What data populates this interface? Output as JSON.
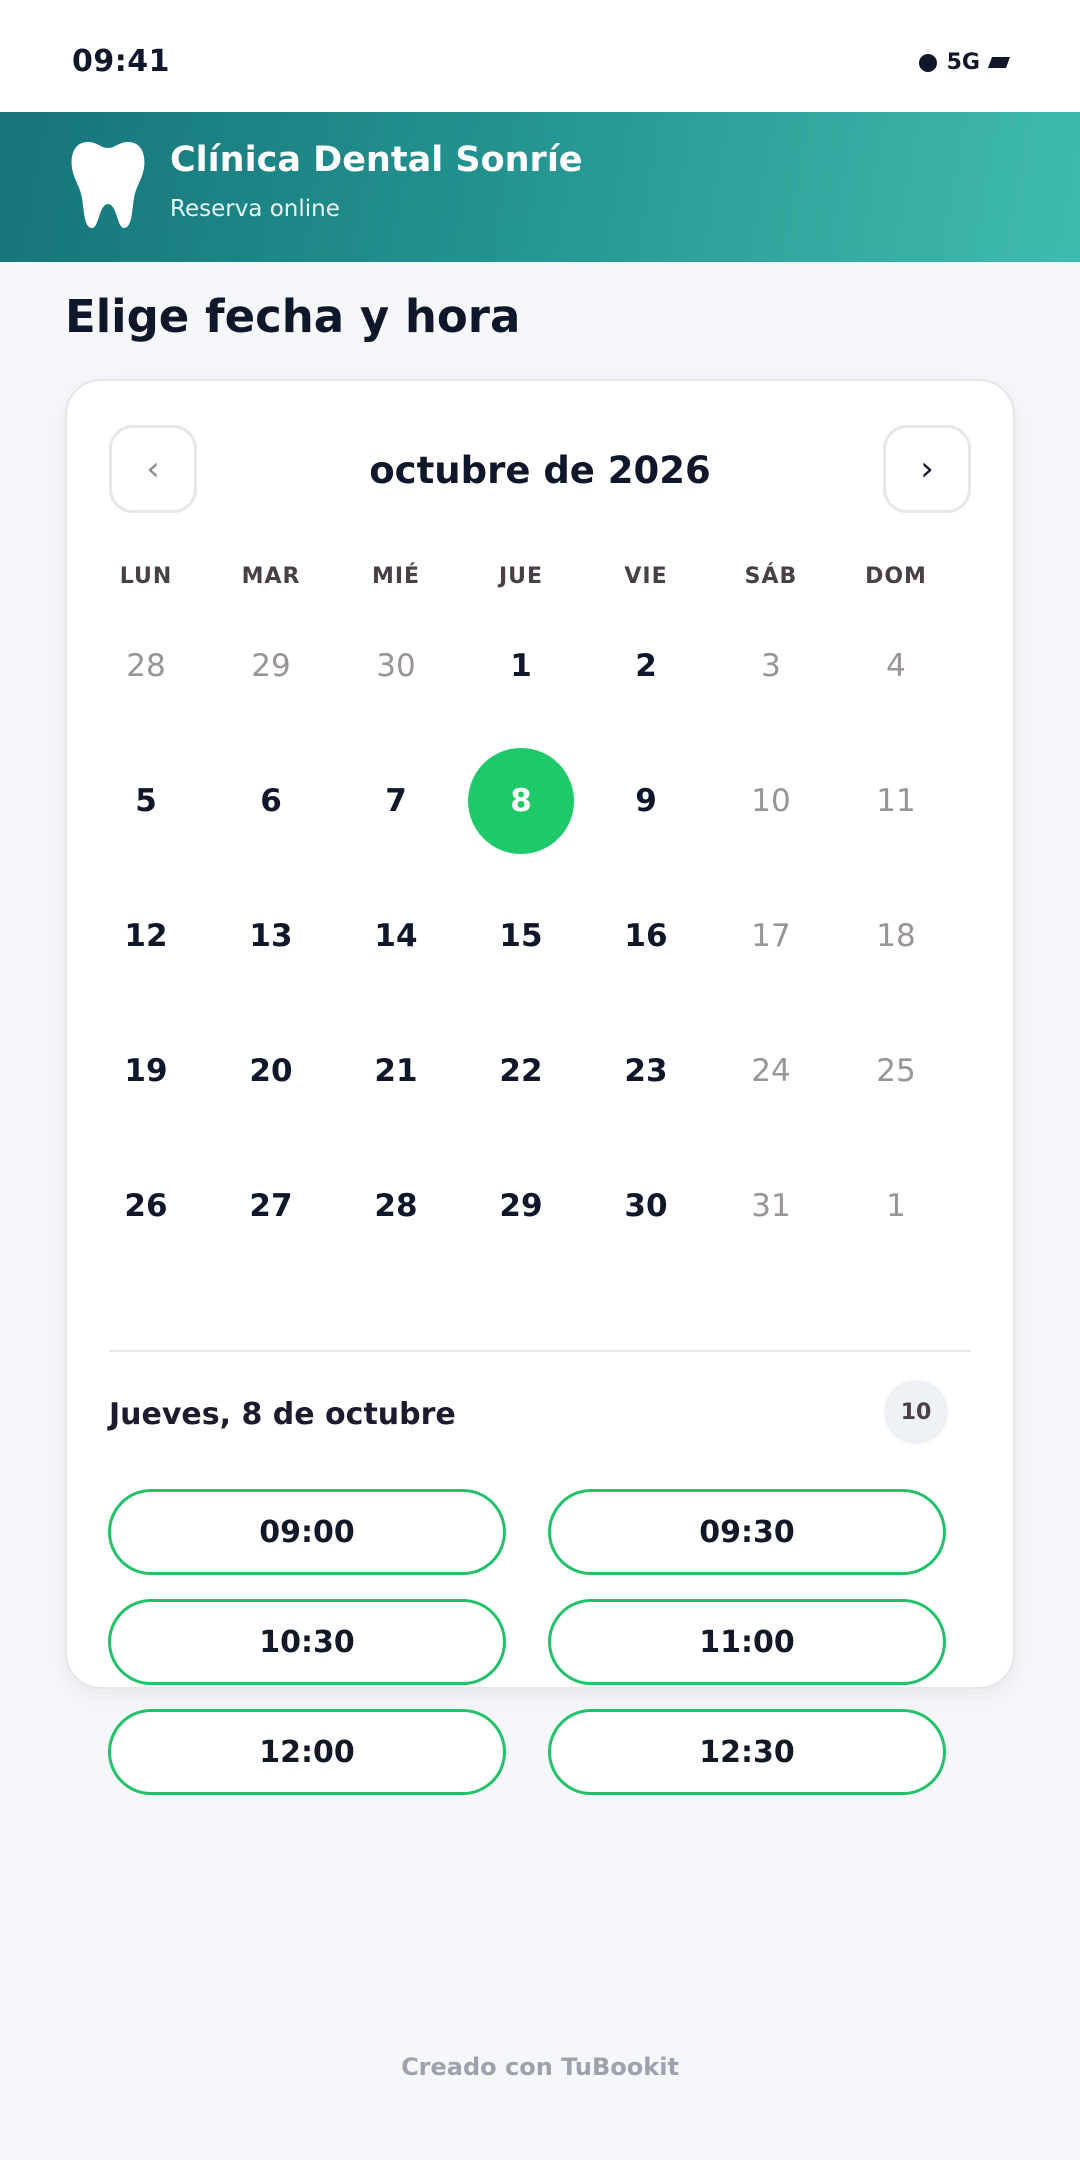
{
  "status": {
    "time": "09:41",
    "network": "5G",
    "icons": [
      "dot-icon",
      "battery-icon"
    ]
  },
  "header": {
    "icon": "tooth-icon",
    "title": "Clínica Dental Sonríe",
    "subtitle": "Reserva online"
  },
  "page": {
    "title": "Elige fecha y hora"
  },
  "calendar": {
    "month_label": "octubre de 2026",
    "prev_icon": "chevron-left-icon",
    "next_icon": "chevron-right-icon",
    "prev_label": "‹",
    "next_label": "›",
    "weekdays": [
      "LUN",
      "MAR",
      "MIÉ",
      "JUE",
      "VIE",
      "SÁB",
      "DOM"
    ],
    "weeks": [
      [
        {
          "d": "28",
          "s": "muted"
        },
        {
          "d": "29",
          "s": "muted"
        },
        {
          "d": "30",
          "s": "muted"
        },
        {
          "d": "1",
          "s": "active"
        },
        {
          "d": "2",
          "s": "active"
        },
        {
          "d": "3",
          "s": "muted"
        },
        {
          "d": "4",
          "s": "muted"
        }
      ],
      [
        {
          "d": "5",
          "s": "active"
        },
        {
          "d": "6",
          "s": "active"
        },
        {
          "d": "7",
          "s": "active"
        },
        {
          "d": "8",
          "s": "selected"
        },
        {
          "d": "9",
          "s": "active"
        },
        {
          "d": "10",
          "s": "muted"
        },
        {
          "d": "11",
          "s": "muted"
        }
      ],
      [
        {
          "d": "12",
          "s": "active"
        },
        {
          "d": "13",
          "s": "active"
        },
        {
          "d": "14",
          "s": "active"
        },
        {
          "d": "15",
          "s": "active"
        },
        {
          "d": "16",
          "s": "active"
        },
        {
          "d": "17",
          "s": "muted"
        },
        {
          "d": "18",
          "s": "muted"
        }
      ],
      [
        {
          "d": "19",
          "s": "active"
        },
        {
          "d": "20",
          "s": "active"
        },
        {
          "d": "21",
          "s": "active"
        },
        {
          "d": "22",
          "s": "active"
        },
        {
          "d": "23",
          "s": "active"
        },
        {
          "d": "24",
          "s": "muted"
        },
        {
          "d": "25",
          "s": "muted"
        }
      ],
      [
        {
          "d": "26",
          "s": "active"
        },
        {
          "d": "27",
          "s": "active"
        },
        {
          "d": "28",
          "s": "active"
        },
        {
          "d": "29",
          "s": "active"
        },
        {
          "d": "30",
          "s": "active"
        },
        {
          "d": "31",
          "s": "muted"
        },
        {
          "d": "1",
          "s": "muted"
        }
      ]
    ]
  },
  "slots_section": {
    "date_label": "Jueves, 8 de octubre",
    "count": "10",
    "times": [
      "09:00",
      "09:30",
      "10:30",
      "11:00",
      "12:00",
      "12:30"
    ]
  },
  "footer": {
    "text": "Creado con TuBookit"
  },
  "colors": {
    "accent": "#1ec96a",
    "header_start": "#16747a",
    "header_end": "#3fbcae",
    "text": "#0f172a"
  }
}
